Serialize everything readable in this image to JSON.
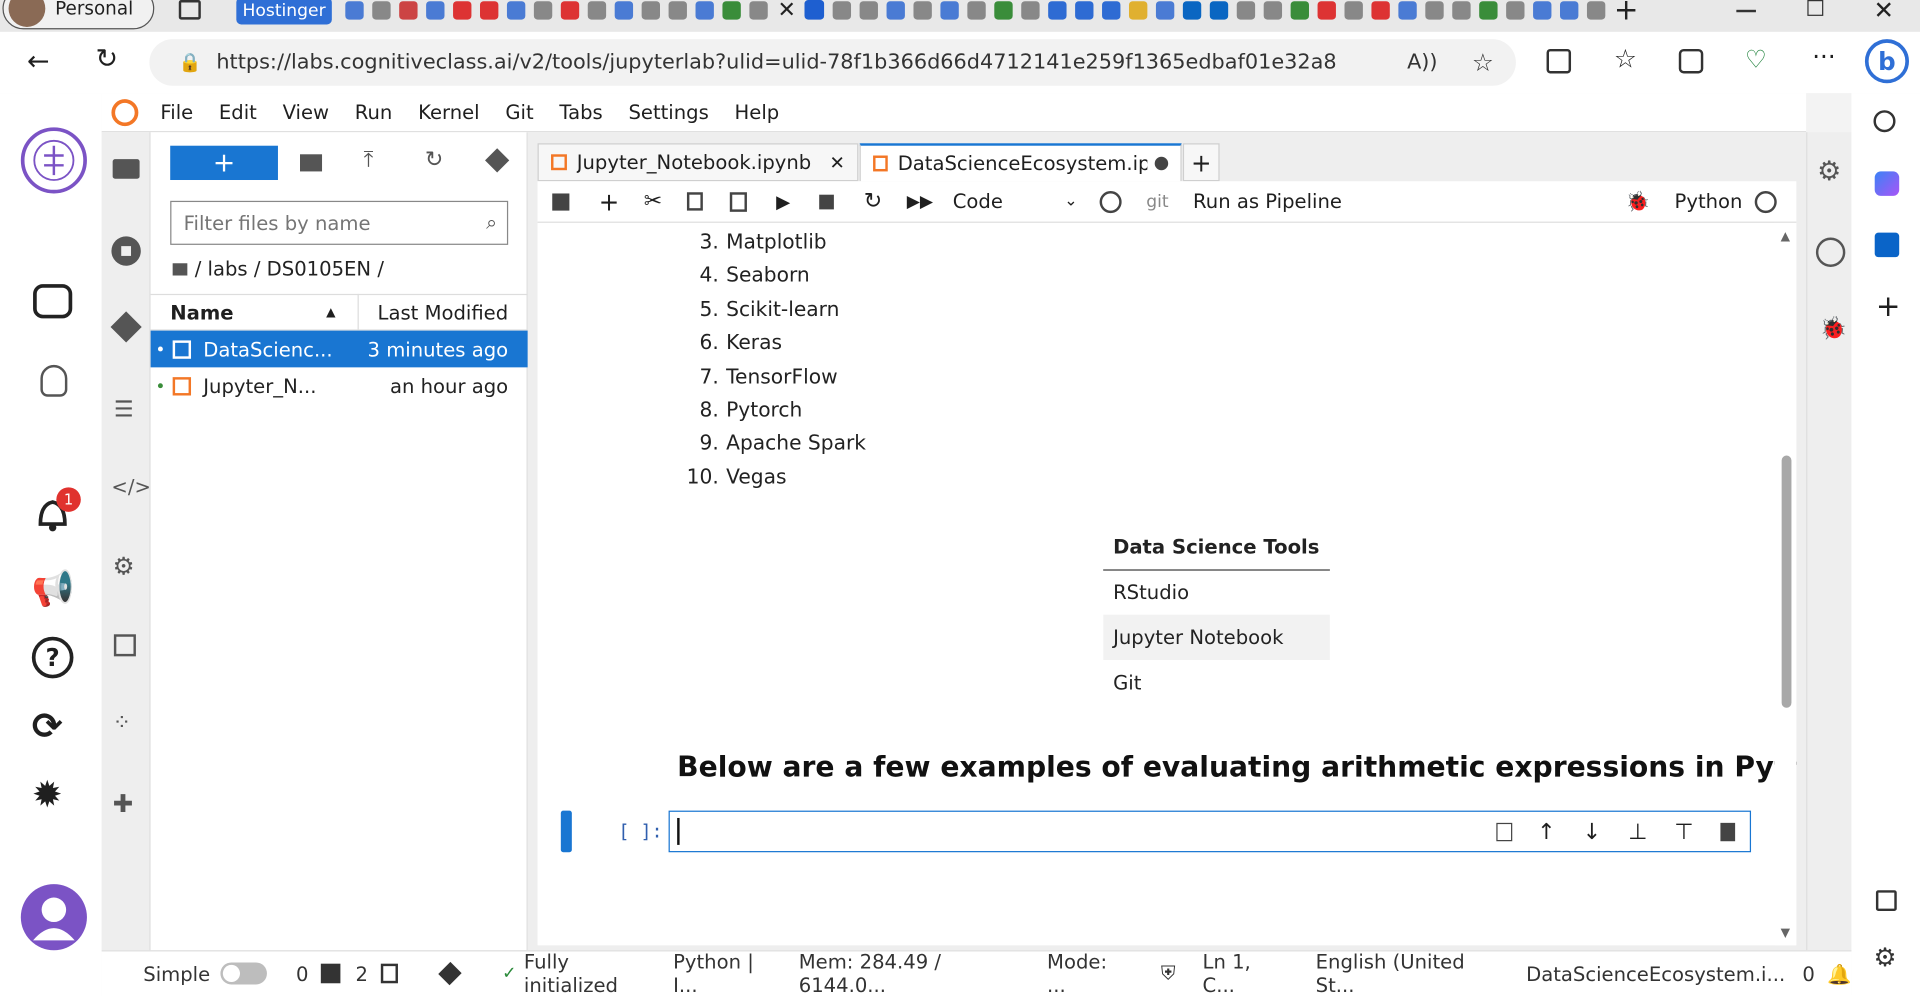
{
  "browser": {
    "profile_label": "Personal",
    "pinned_tab_label": "Hostinger",
    "url": "https://labs.cognitiveclass.ai/v2/tools/jupyterlab?ulid=ulid-78f1b366d66d4712141e259f1365edbaf01e32a8",
    "accent_color": "#2f6fd6"
  },
  "jupyter": {
    "menu": [
      "File",
      "Edit",
      "View",
      "Run",
      "Kernel",
      "Git",
      "Tabs",
      "Settings",
      "Help"
    ],
    "filebrowser": {
      "filter_placeholder": "Filter files by name",
      "breadcrumb": "/ labs / DS0105EN /",
      "col_name": "Name",
      "col_modified": "Last Modified",
      "files": [
        {
          "name": "DataScienc...",
          "modified": "3 minutes ago",
          "selected": true
        },
        {
          "name": "Jupyter_N...",
          "modified": "an hour ago",
          "selected": false
        }
      ]
    },
    "tabs": [
      {
        "label": "Jupyter_Notebook.ipynb",
        "active": false
      },
      {
        "label": "DataScienceEcosystem.ipyn",
        "active": true
      }
    ],
    "toolbar": {
      "cell_type": "Code",
      "git_label": "git",
      "pipeline_label": "Run as Pipeline",
      "kernel_name": "Python"
    },
    "notebook": {
      "list_items": [
        {
          "num": "3.",
          "text": "Matplotlib"
        },
        {
          "num": "4.",
          "text": "Seaborn"
        },
        {
          "num": "5.",
          "text": "Scikit-learn"
        },
        {
          "num": "6.",
          "text": "Keras"
        },
        {
          "num": "7.",
          "text": "TensorFlow"
        },
        {
          "num": "8.",
          "text": "Pytorch"
        },
        {
          "num": "9.",
          "text": "Apache Spark"
        },
        {
          "num": "10.",
          "text": "Vegas"
        }
      ],
      "table_header": "Data Science Tools",
      "table_rows": [
        "RStudio",
        "Jupyter Notebook",
        "Git"
      ],
      "heading": "Below are a few examples of evaluating arithmetic expressions in Python",
      "prompt": "[ ]:"
    },
    "status": {
      "mode_label": "Simple",
      "terminals": "0",
      "kernels": "2",
      "init": "Fully initialized",
      "kernel": "Python | I...",
      "mem": "Mem: 284.49 / 6144.0...",
      "mode": "Mode: ...",
      "pos": "Ln 1, C...",
      "lang": "English (United St...",
      "file": "DataScienceEcosystem.i...",
      "notif_count": "0"
    }
  },
  "left_panel": {
    "notification_badge": "1"
  }
}
